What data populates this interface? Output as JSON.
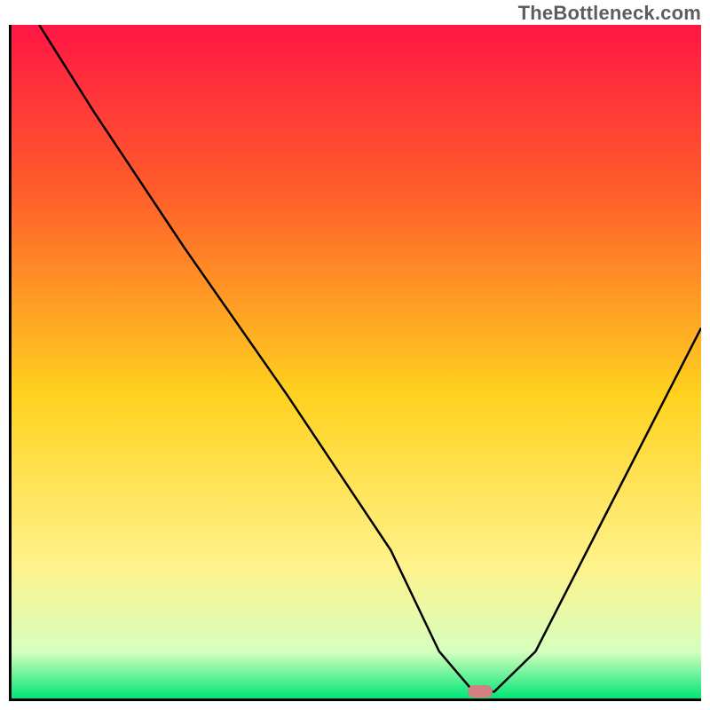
{
  "watermark": "TheBottleneck.com",
  "colors": {
    "gradient_top": "#ff1744",
    "gradient_mid_high": "#ff6e2a",
    "gradient_mid": "#ffd21f",
    "gradient_mid_low": "#fff07a",
    "gradient_low": "#d7ffbf",
    "gradient_bottom": "#00e676",
    "axis": "#000000",
    "curve": "#000000",
    "marker": "#d08080"
  },
  "chart_data": {
    "type": "line",
    "title": "",
    "xlabel": "",
    "ylabel": "",
    "xlim": [
      0,
      100
    ],
    "ylim": [
      0,
      100
    ],
    "series": [
      {
        "name": "bottleneck-curve",
        "x": [
          4,
          12,
          25,
          40,
          55,
          62,
          67,
          70,
          76,
          85,
          100
        ],
        "values": [
          100,
          87,
          67,
          45,
          22,
          7,
          1,
          1,
          7,
          25,
          55
        ]
      }
    ],
    "marker": {
      "x": 68,
      "y": 1
    },
    "gradient_stops": [
      {
        "offset": 0,
        "color": "#ff1744"
      },
      {
        "offset": 25,
        "color": "#ff5e2a"
      },
      {
        "offset": 55,
        "color": "#ffd21f"
      },
      {
        "offset": 80,
        "color": "#fff28a"
      },
      {
        "offset": 93,
        "color": "#d7ffbf"
      },
      {
        "offset": 100,
        "color": "#00e676"
      }
    ]
  }
}
